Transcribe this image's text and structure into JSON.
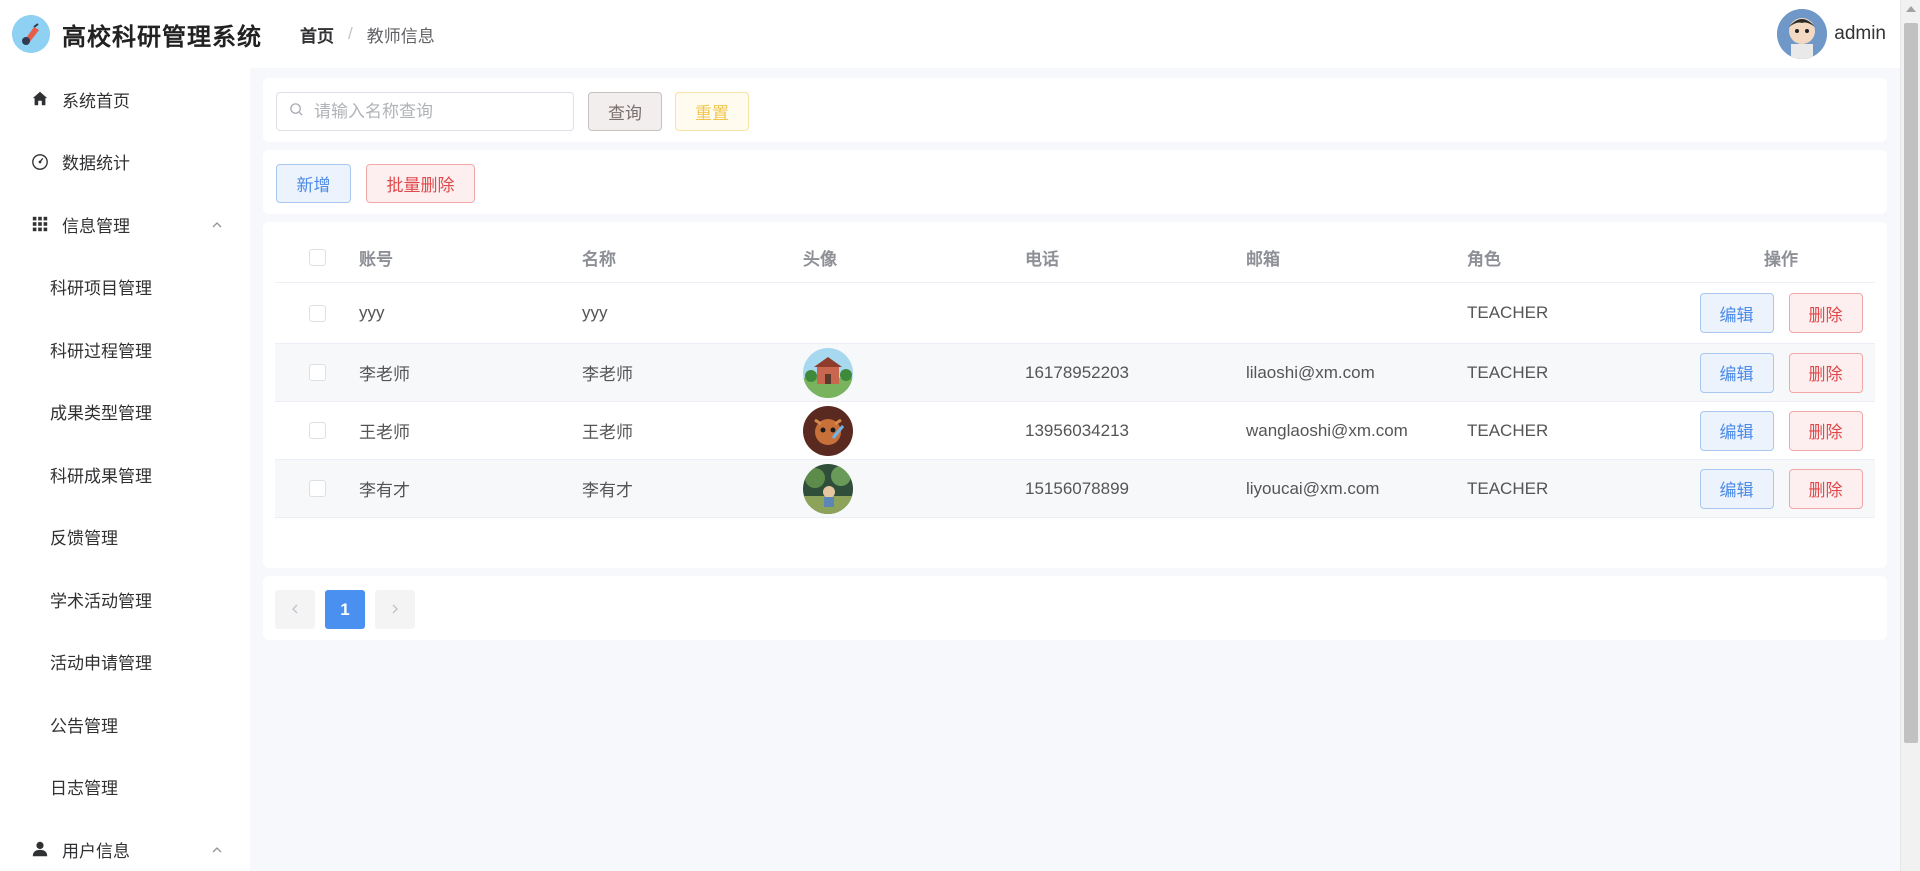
{
  "app": {
    "title": "高校科研管理系统"
  },
  "breadcrumb": {
    "home": "首页",
    "separator": "/",
    "current": "教师信息"
  },
  "user": {
    "name": "admin"
  },
  "sidebar": {
    "items": [
      {
        "label": "系统首页",
        "icon": "home-icon"
      },
      {
        "label": "数据统计",
        "icon": "dashboard-icon"
      },
      {
        "label": "信息管理",
        "icon": "grid-icon",
        "expanded": true
      },
      {
        "label": "科研项目管理"
      },
      {
        "label": "科研过程管理"
      },
      {
        "label": "成果类型管理"
      },
      {
        "label": "科研成果管理"
      },
      {
        "label": "反馈管理"
      },
      {
        "label": "学术活动管理"
      },
      {
        "label": "活动申请管理"
      },
      {
        "label": "公告管理"
      },
      {
        "label": "日志管理"
      },
      {
        "label": "用户信息",
        "icon": "user-icon",
        "expanded": true
      }
    ]
  },
  "search": {
    "placeholder": "请输入名称查询",
    "value": "",
    "query_label": "查询",
    "reset_label": "重置"
  },
  "actions": {
    "add_label": "新增",
    "batch_delete_label": "批量删除"
  },
  "table": {
    "columns": [
      "账号",
      "名称",
      "头像",
      "电话",
      "邮箱",
      "角色",
      "操作"
    ],
    "edit_label": "编辑",
    "delete_label": "删除",
    "rows": [
      {
        "account": "yyy",
        "name": "yyy",
        "avatar": "",
        "phone": "",
        "email": "",
        "role": "TEACHER"
      },
      {
        "account": "李老师",
        "name": "李老师",
        "avatar": "school-building-image",
        "phone": "16178952203",
        "email": "lilaoshi@xm.com",
        "role": "TEACHER"
      },
      {
        "account": "王老师",
        "name": "王老师",
        "avatar": "cartoon-character-image",
        "phone": "13956034213",
        "email": "wanglaoshi@xm.com",
        "role": "TEACHER"
      },
      {
        "account": "李有才",
        "name": "李有才",
        "avatar": "garden-scene-image",
        "phone": "15156078899",
        "email": "liyoucai@xm.com",
        "role": "TEACHER"
      }
    ]
  },
  "pagination": {
    "current_page": "1",
    "prev_icon": "chevron-left-icon",
    "next_icon": "chevron-right-icon"
  },
  "colors": {
    "primary": "#4a90f0",
    "danger": "#e0494b",
    "warning": "#f1c64f",
    "background": "#f6f8fb"
  }
}
